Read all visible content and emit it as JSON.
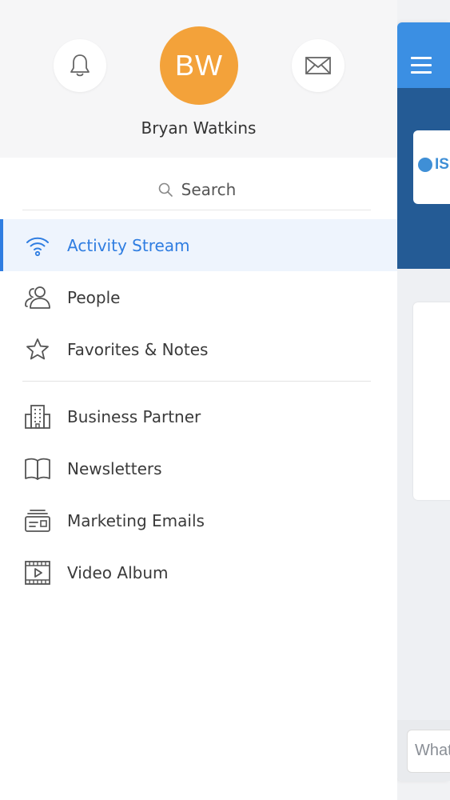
{
  "profile": {
    "initials": "BW",
    "name": "Bryan Watkins",
    "avatar_color": "#f3a23a",
    "notifications_icon": "bell-icon",
    "messages_icon": "mail-icon"
  },
  "search": {
    "label": "Search",
    "icon": "search-icon"
  },
  "menu": {
    "primary": [
      {
        "label": "Activity Stream",
        "icon": "wifi-signal-icon",
        "active": true
      },
      {
        "label": "People",
        "icon": "people-icon",
        "active": false
      },
      {
        "label": "Favorites & Notes",
        "icon": "star-icon",
        "active": false
      }
    ],
    "secondary": [
      {
        "label": "Business Partner",
        "icon": "building-icon"
      },
      {
        "label": "Newsletters",
        "icon": "book-icon"
      },
      {
        "label": "Marketing Emails",
        "icon": "envelope-stack-icon"
      },
      {
        "label": "Video Album",
        "icon": "film-icon"
      }
    ]
  },
  "background_app": {
    "logo_text": "IS",
    "composer_placeholder": "What"
  },
  "colors": {
    "accent": "#2f7de1",
    "active_bg": "#eef4fd",
    "topbar": "#3b8fe3",
    "banner": "#245b95"
  }
}
